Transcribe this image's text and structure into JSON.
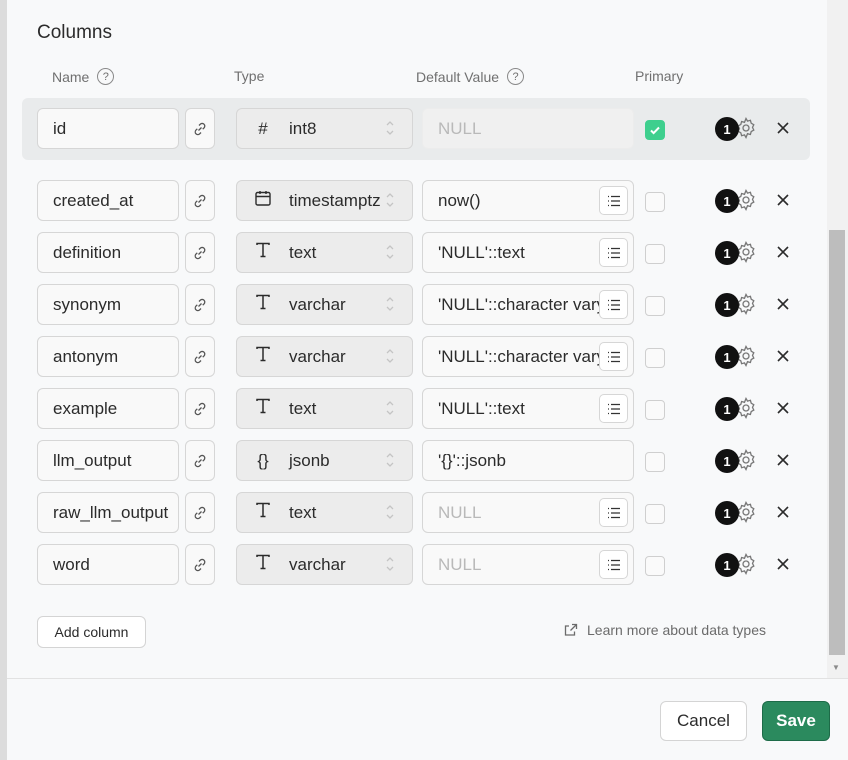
{
  "section_title": "Columns",
  "headers": {
    "name": "Name",
    "type": "Type",
    "default_value": "Default Value",
    "primary": "Primary",
    "help_glyph": "?"
  },
  "rows": [
    {
      "name": "id",
      "type": "int8",
      "type_icon": "#",
      "default": "NULL",
      "default_is_placeholder": true,
      "has_list_button": false,
      "primary": true,
      "badge": "1",
      "primary_row": true
    },
    {
      "name": "created_at",
      "type": "timestamptz",
      "type_icon": "calendar",
      "default": "now()",
      "default_is_placeholder": false,
      "has_list_button": true,
      "primary": false,
      "badge": "1"
    },
    {
      "name": "definition",
      "type": "text",
      "type_icon": "T",
      "default": "'NULL'::text",
      "default_is_placeholder": false,
      "has_list_button": true,
      "primary": false,
      "badge": "1"
    },
    {
      "name": "synonym",
      "type": "varchar",
      "type_icon": "T",
      "default": "'NULL'::character varying",
      "default_is_placeholder": false,
      "has_list_button": true,
      "primary": false,
      "badge": "1"
    },
    {
      "name": "antonym",
      "type": "varchar",
      "type_icon": "T",
      "default": "'NULL'::character varying",
      "default_is_placeholder": false,
      "has_list_button": true,
      "primary": false,
      "badge": "1"
    },
    {
      "name": "example",
      "type": "text",
      "type_icon": "T",
      "default": "'NULL'::text",
      "default_is_placeholder": false,
      "has_list_button": true,
      "primary": false,
      "badge": "1"
    },
    {
      "name": "llm_output",
      "type": "jsonb",
      "type_icon": "{}",
      "default": "'{}'::jsonb",
      "default_is_placeholder": false,
      "has_list_button": false,
      "primary": false,
      "badge": "1"
    },
    {
      "name": "raw_llm_output",
      "type": "text",
      "type_icon": "T",
      "default": "NULL",
      "default_is_placeholder": true,
      "has_list_button": true,
      "primary": false,
      "badge": "1"
    },
    {
      "name": "word",
      "type": "varchar",
      "type_icon": "T",
      "default": "NULL",
      "default_is_placeholder": true,
      "has_list_button": true,
      "primary": false,
      "badge": "1"
    }
  ],
  "add_column_label": "Add column",
  "learn_more_label": "Learn more about data types",
  "cancel_label": "Cancel",
  "save_label": "Save",
  "colors": {
    "accent_green": "#3ecf8e",
    "save_green": "#2b8a5e",
    "panel_bg": "#f8f9fa"
  }
}
